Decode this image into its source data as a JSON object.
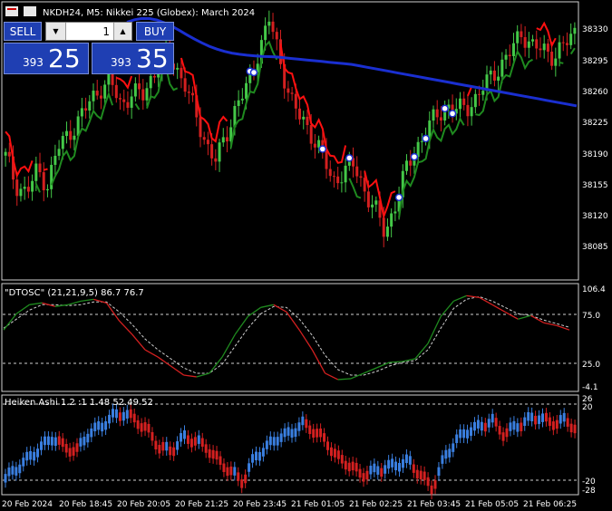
{
  "window": {
    "title": "NKDH24, M5:  Nikkei 225 (Globex): March 2024"
  },
  "trade_panel": {
    "sell_label": "SELL",
    "buy_label": "BUY",
    "lot_value": "1",
    "sell_price_small": "393",
    "sell_price_big": "25",
    "buy_price_small": "393",
    "buy_price_big": "35"
  },
  "main_axis": {
    "ticks": [
      "38330",
      "38295",
      "38260",
      "38225",
      "38190",
      "38155",
      "38120",
      "38085"
    ]
  },
  "osc_panel": {
    "title": "\"DTOSC\" (21,21,9,5) 86.7 76.7",
    "ticks": [
      "106.4",
      "75.0",
      "25.0",
      "-4.1"
    ]
  },
  "ha_panel": {
    "title": "Heiken Ashi 1.2 :1 1.48 52.49 52",
    "ticks": [
      "26",
      "20",
      "-20",
      "-28"
    ]
  },
  "time_axis": {
    "labels": [
      "20 Feb 2024",
      "20 Feb 18:45",
      "20 Feb 20:05",
      "20 Feb 21:25",
      "20 Feb 23:45",
      "21 Feb 01:05",
      "21 Feb 02:25",
      "21 Feb 03:45",
      "21 Feb 05:05",
      "21 Feb 06:25"
    ]
  },
  "colors": {
    "bull": "#44c848",
    "bear": "#d42020",
    "ma": "#1a2fd0",
    "trail_green": "#1f8a1f",
    "trail_red": "#ff1010",
    "ha_blue": "#3a7fe0",
    "ha_red": "#d42020"
  },
  "chart_data": [
    {
      "type": "line",
      "title": "NKDH24, M5:  Nikkei 225 (Globex): March 2024",
      "ylim": [
        38060,
        38355
      ],
      "series": [
        {
          "values": [
            38190,
            38160,
            38150,
            38175,
            38160,
            38200,
            38215,
            38230,
            38250,
            38265,
            38270,
            38245,
            38260,
            38255,
            38280,
            38300,
            38290,
            38270,
            38235,
            38205,
            38185,
            38215,
            38250,
            38265,
            38305,
            38340,
            38295,
            38255,
            38230,
            38215,
            38195,
            38160,
            38175,
            38180,
            38155,
            38135,
            38105,
            38140,
            38175,
            38200,
            38220,
            38235,
            38245,
            38240,
            38245,
            38260,
            38275,
            38290,
            38305,
            38325,
            38310,
            38305,
            38300,
            38310,
            38325
          ]
        }
      ]
    },
    {
      "type": "line",
      "title": "\"DTOSC\" (21,21,9,5) 86.7 76.7",
      "ylim": [
        -4.1,
        106.4
      ],
      "series": [
        {
          "values": [
            60,
            78,
            88,
            90,
            86,
            88,
            92,
            94,
            90,
            70,
            55,
            38,
            30,
            20,
            10,
            8,
            12,
            30,
            55,
            75,
            85,
            88,
            80,
            60,
            38,
            12,
            5,
            6,
            12,
            18,
            24,
            25,
            28,
            45,
            75,
            92,
            98,
            96,
            88,
            80,
            72,
            76,
            68,
            65,
            60
          ]
        },
        {
          "values": [
            62,
            72,
            82,
            88,
            88,
            87,
            88,
            91,
            91,
            80,
            66,
            50,
            38,
            28,
            18,
            12,
            12,
            22,
            42,
            62,
            78,
            86,
            85,
            72,
            54,
            32,
            16,
            10,
            10,
            14,
            20,
            24,
            26,
            38,
            62,
            84,
            94,
            97,
            92,
            85,
            78,
            76,
            71,
            67,
            63
          ]
        }
      ]
    },
    {
      "type": "bar",
      "title": "Heiken Ashi 1.2 :1 1.48 52.49 52",
      "ylim": [
        -28,
        26
      ],
      "values": [
        -18,
        -12,
        -6,
        0,
        6,
        0,
        -2,
        8,
        12,
        18,
        20,
        16,
        10,
        0,
        -2,
        6,
        4,
        0,
        -8,
        -14,
        -20,
        -6,
        0,
        6,
        8,
        14,
        10,
        4,
        -6,
        -10,
        -16,
        -14,
        -12,
        -10,
        -8,
        -16,
        -24,
        -6,
        4,
        10,
        12,
        16,
        8,
        12,
        16,
        18,
        14,
        16,
        12
      ]
    }
  ]
}
